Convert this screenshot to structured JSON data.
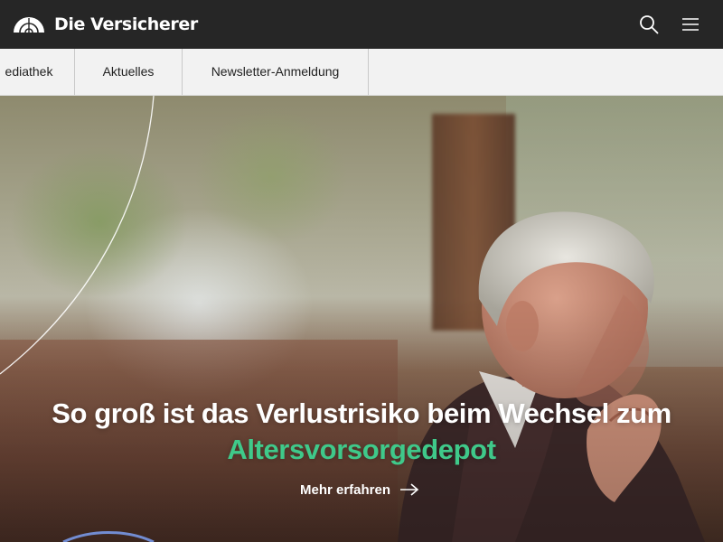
{
  "header": {
    "brand": "Die Versicherer",
    "icons": {
      "search": "search-icon",
      "menu": "hamburger-menu-icon",
      "logo": "rainbow-arc-logo-icon"
    }
  },
  "subnav": {
    "items": [
      {
        "label": "ediathek"
      },
      {
        "label": "Aktuelles"
      },
      {
        "label": "Newsletter-Anmeldung"
      }
    ]
  },
  "hero": {
    "headline_line1": "So groß ist das Verlustrisiko beim Wechsel zum",
    "headline_line2": "Altersvorsorgedepot",
    "cta_label": "Mehr erfahren",
    "cta_icon": "arrow-right-icon",
    "colors": {
      "accent": "#3fc98a",
      "text": "#ffffff",
      "header_bg": "#262626",
      "subnav_bg": "#f2f2f2"
    }
  }
}
